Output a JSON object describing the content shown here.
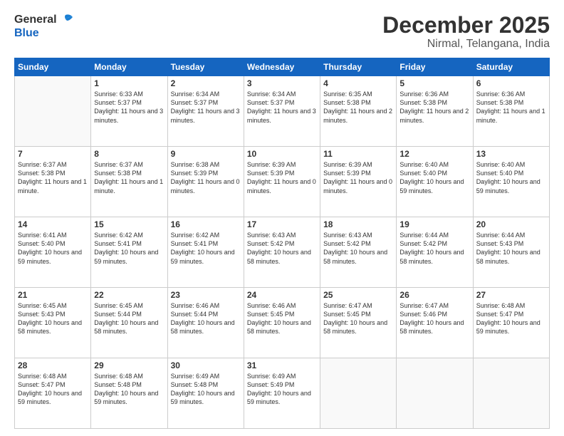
{
  "header": {
    "logo_general": "General",
    "logo_blue": "Blue",
    "title": "December 2025",
    "subtitle": "Nirmal, Telangana, India"
  },
  "weekdays": [
    "Sunday",
    "Monday",
    "Tuesday",
    "Wednesday",
    "Thursday",
    "Friday",
    "Saturday"
  ],
  "weeks": [
    [
      {
        "day": "",
        "sunrise": "",
        "sunset": "",
        "daylight": ""
      },
      {
        "day": "1",
        "sunrise": "Sunrise: 6:33 AM",
        "sunset": "Sunset: 5:37 PM",
        "daylight": "Daylight: 11 hours and 3 minutes."
      },
      {
        "day": "2",
        "sunrise": "Sunrise: 6:34 AM",
        "sunset": "Sunset: 5:37 PM",
        "daylight": "Daylight: 11 hours and 3 minutes."
      },
      {
        "day": "3",
        "sunrise": "Sunrise: 6:34 AM",
        "sunset": "Sunset: 5:37 PM",
        "daylight": "Daylight: 11 hours and 3 minutes."
      },
      {
        "day": "4",
        "sunrise": "Sunrise: 6:35 AM",
        "sunset": "Sunset: 5:38 PM",
        "daylight": "Daylight: 11 hours and 2 minutes."
      },
      {
        "day": "5",
        "sunrise": "Sunrise: 6:36 AM",
        "sunset": "Sunset: 5:38 PM",
        "daylight": "Daylight: 11 hours and 2 minutes."
      },
      {
        "day": "6",
        "sunrise": "Sunrise: 6:36 AM",
        "sunset": "Sunset: 5:38 PM",
        "daylight": "Daylight: 11 hours and 1 minute."
      }
    ],
    [
      {
        "day": "7",
        "sunrise": "Sunrise: 6:37 AM",
        "sunset": "Sunset: 5:38 PM",
        "daylight": "Daylight: 11 hours and 1 minute."
      },
      {
        "day": "8",
        "sunrise": "Sunrise: 6:37 AM",
        "sunset": "Sunset: 5:38 PM",
        "daylight": "Daylight: 11 hours and 1 minute."
      },
      {
        "day": "9",
        "sunrise": "Sunrise: 6:38 AM",
        "sunset": "Sunset: 5:39 PM",
        "daylight": "Daylight: 11 hours and 0 minutes."
      },
      {
        "day": "10",
        "sunrise": "Sunrise: 6:39 AM",
        "sunset": "Sunset: 5:39 PM",
        "daylight": "Daylight: 11 hours and 0 minutes."
      },
      {
        "day": "11",
        "sunrise": "Sunrise: 6:39 AM",
        "sunset": "Sunset: 5:39 PM",
        "daylight": "Daylight: 11 hours and 0 minutes."
      },
      {
        "day": "12",
        "sunrise": "Sunrise: 6:40 AM",
        "sunset": "Sunset: 5:40 PM",
        "daylight": "Daylight: 10 hours and 59 minutes."
      },
      {
        "day": "13",
        "sunrise": "Sunrise: 6:40 AM",
        "sunset": "Sunset: 5:40 PM",
        "daylight": "Daylight: 10 hours and 59 minutes."
      }
    ],
    [
      {
        "day": "14",
        "sunrise": "Sunrise: 6:41 AM",
        "sunset": "Sunset: 5:40 PM",
        "daylight": "Daylight: 10 hours and 59 minutes."
      },
      {
        "day": "15",
        "sunrise": "Sunrise: 6:42 AM",
        "sunset": "Sunset: 5:41 PM",
        "daylight": "Daylight: 10 hours and 59 minutes."
      },
      {
        "day": "16",
        "sunrise": "Sunrise: 6:42 AM",
        "sunset": "Sunset: 5:41 PM",
        "daylight": "Daylight: 10 hours and 59 minutes."
      },
      {
        "day": "17",
        "sunrise": "Sunrise: 6:43 AM",
        "sunset": "Sunset: 5:42 PM",
        "daylight": "Daylight: 10 hours and 58 minutes."
      },
      {
        "day": "18",
        "sunrise": "Sunrise: 6:43 AM",
        "sunset": "Sunset: 5:42 PM",
        "daylight": "Daylight: 10 hours and 58 minutes."
      },
      {
        "day": "19",
        "sunrise": "Sunrise: 6:44 AM",
        "sunset": "Sunset: 5:42 PM",
        "daylight": "Daylight: 10 hours and 58 minutes."
      },
      {
        "day": "20",
        "sunrise": "Sunrise: 6:44 AM",
        "sunset": "Sunset: 5:43 PM",
        "daylight": "Daylight: 10 hours and 58 minutes."
      }
    ],
    [
      {
        "day": "21",
        "sunrise": "Sunrise: 6:45 AM",
        "sunset": "Sunset: 5:43 PM",
        "daylight": "Daylight: 10 hours and 58 minutes."
      },
      {
        "day": "22",
        "sunrise": "Sunrise: 6:45 AM",
        "sunset": "Sunset: 5:44 PM",
        "daylight": "Daylight: 10 hours and 58 minutes."
      },
      {
        "day": "23",
        "sunrise": "Sunrise: 6:46 AM",
        "sunset": "Sunset: 5:44 PM",
        "daylight": "Daylight: 10 hours and 58 minutes."
      },
      {
        "day": "24",
        "sunrise": "Sunrise: 6:46 AM",
        "sunset": "Sunset: 5:45 PM",
        "daylight": "Daylight: 10 hours and 58 minutes."
      },
      {
        "day": "25",
        "sunrise": "Sunrise: 6:47 AM",
        "sunset": "Sunset: 5:45 PM",
        "daylight": "Daylight: 10 hours and 58 minutes."
      },
      {
        "day": "26",
        "sunrise": "Sunrise: 6:47 AM",
        "sunset": "Sunset: 5:46 PM",
        "daylight": "Daylight: 10 hours and 58 minutes."
      },
      {
        "day": "27",
        "sunrise": "Sunrise: 6:48 AM",
        "sunset": "Sunset: 5:47 PM",
        "daylight": "Daylight: 10 hours and 59 minutes."
      }
    ],
    [
      {
        "day": "28",
        "sunrise": "Sunrise: 6:48 AM",
        "sunset": "Sunset: 5:47 PM",
        "daylight": "Daylight: 10 hours and 59 minutes."
      },
      {
        "day": "29",
        "sunrise": "Sunrise: 6:48 AM",
        "sunset": "Sunset: 5:48 PM",
        "daylight": "Daylight: 10 hours and 59 minutes."
      },
      {
        "day": "30",
        "sunrise": "Sunrise: 6:49 AM",
        "sunset": "Sunset: 5:48 PM",
        "daylight": "Daylight: 10 hours and 59 minutes."
      },
      {
        "day": "31",
        "sunrise": "Sunrise: 6:49 AM",
        "sunset": "Sunset: 5:49 PM",
        "daylight": "Daylight: 10 hours and 59 minutes."
      },
      {
        "day": "",
        "sunrise": "",
        "sunset": "",
        "daylight": ""
      },
      {
        "day": "",
        "sunrise": "",
        "sunset": "",
        "daylight": ""
      },
      {
        "day": "",
        "sunrise": "",
        "sunset": "",
        "daylight": ""
      }
    ]
  ]
}
